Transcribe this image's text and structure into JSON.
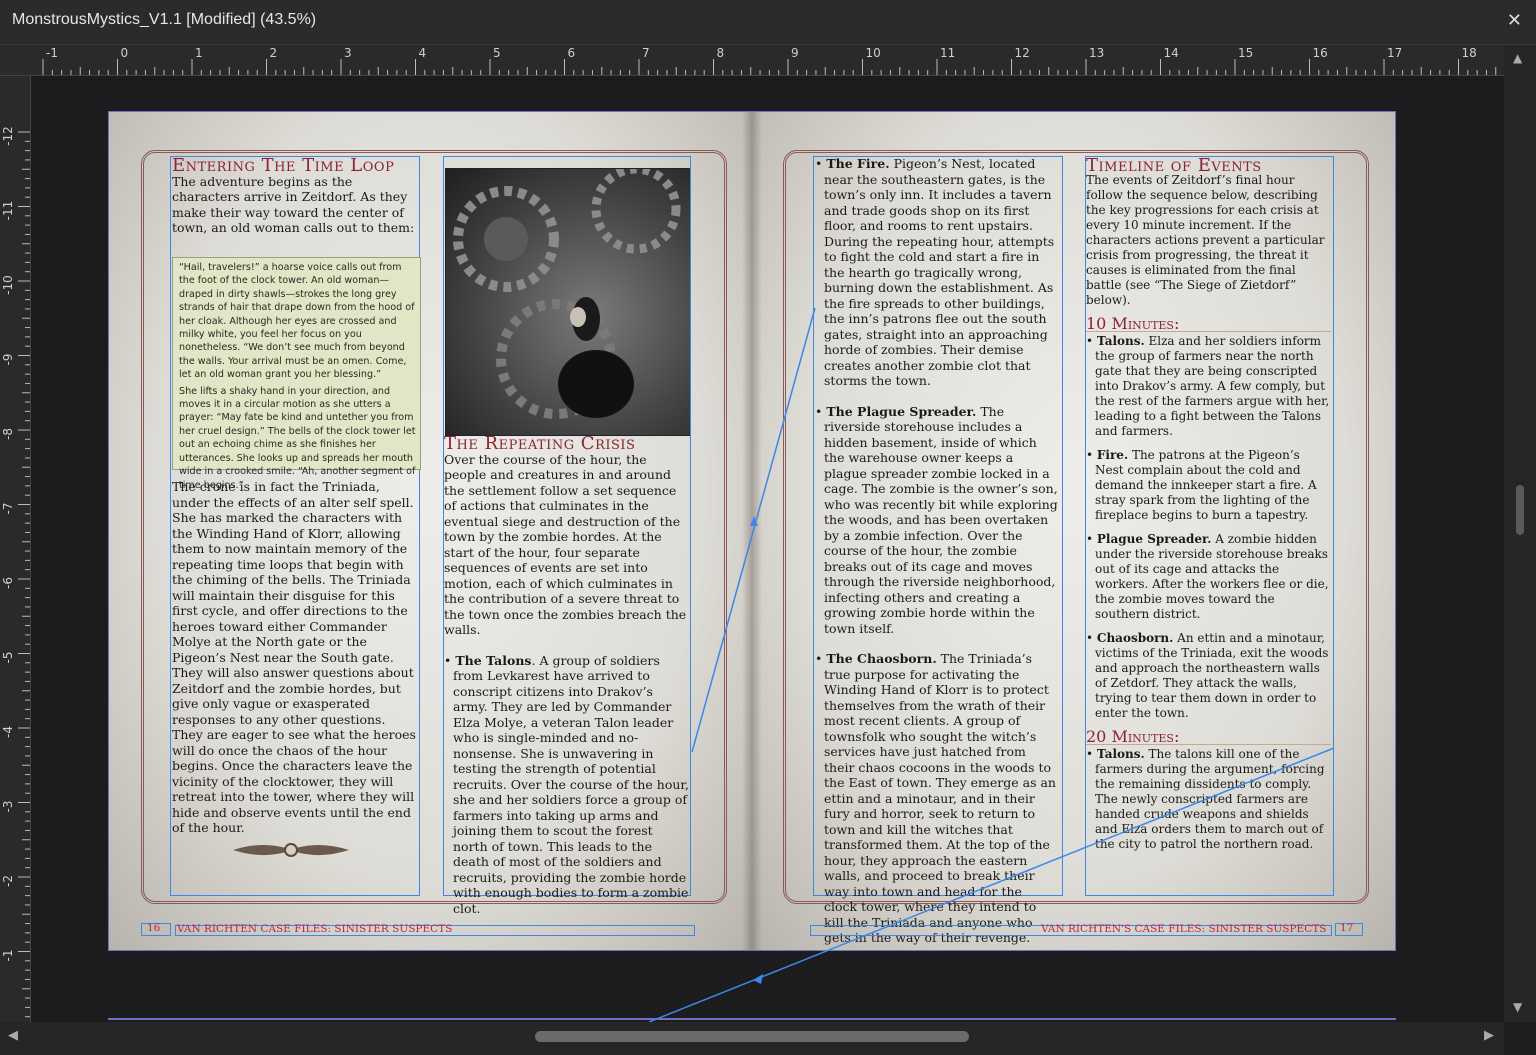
{
  "window": {
    "title": "MonstrousMystics_V1.1 [Modified] (43.5%)",
    "close_glyph": "✕"
  },
  "ruler": {
    "unit": "in",
    "h_labels": [
      "-1",
      "0",
      "1",
      "2",
      "3",
      "4",
      "5",
      "6",
      "7",
      "8",
      "9",
      "10",
      "11",
      "12",
      "13",
      "14",
      "15",
      "16",
      "17",
      "18"
    ],
    "v_labels": [
      "-12",
      "-11",
      "-10",
      "-9",
      "-8",
      "-7",
      "-6",
      "-5",
      "-4",
      "-3",
      "-2",
      "-1"
    ]
  },
  "left_page": {
    "h1": "Entering The Time Loop",
    "intro": "The adventure begins as the characters arrive in Zeitdorf. As they make their way toward the center of town, an old woman calls out to them:",
    "box_p1": "“Hail, travelers!” a hoarse voice calls out from the foot of the clock tower. An old woman—draped in dirty shawls—strokes the long grey strands of hair that drape down from the hood of her cloak. Although her eyes are crossed and milky white, you feel her focus on you nonetheless. “We don’t see much from beyond the walls. Your arrival must be an omen. Come, let an old woman grant you her blessing.”",
    "box_p2": "She lifts a shaky hand in your direction, and moves it in a circular motion as she utters a prayer: “May fate be kind and untether you from her cruel design.” The bells of the clock tower let out an echoing chime as she finishes her utterances. She looks up and spreads her mouth wide in a crooked smile. “Ah, another segment of time begins.”",
    "body": "The crone is in fact the Triniada, under the effects of an alter self spell. She has marked the characters with the Winding Hand of Klorr, allowing them to now maintain memory of the repeating time loops that begin with the chiming of the bells. The Triniada will maintain their disguise for this first cycle, and offer directions to the heroes toward either Commander Molye at the North gate or the Pigeon’s Nest near the South gate. They will also answer questions about Zeitdorf and the zombie hordes, but give only vague or exasperated responses to any other questions. They are eager to see what the heroes will do once the chaos of the hour begins. Once the characters leave the vicinity of the clocktower, they will retreat into the tower, where they will hide and observe events until the end of the hour.",
    "h2": "The Repeating Crisis",
    "crisis": "Over the course of the hour, the people and creatures in and around the settlement follow a set sequence of actions that culminates in the eventual siege and destruction of the town by the zombie hordes. At the start of the hour, four separate sequences of events are set into motion, each of which culminates in the contribution of a severe threat to the town once the zombies breach the walls.",
    "talons_title": "The Talons",
    "talons": "A group of soldiers from Levkarest have arrived to conscript citizens into Drakov’s army. They are led by Commander Elza Molye, a veteran Talon leader who is single-minded and no-nonsense. She is unwavering in testing the strength of potential recruits. Over the course of the hour, she and her soldiers force a group of farmers into taking up arms and joining them to scout the forest north of town. This leads to the death of most of the soldiers and recruits, providing the zombie horde with enough bodies to form a zombie clot.",
    "page_no": "16",
    "footer": "VAN RICHTEN CASE FILES: SINISTER SUSPECTS"
  },
  "right_page": {
    "fire_title": "The Fire.",
    "fire": "Pigeon’s Nest, located near the southeastern gates, is the town’s only inn. It includes a tavern and trade goods shop on its first floor, and rooms to rent upstairs. During the repeating hour, attempts to fight the cold and start a fire in the hearth go tragically wrong, burning down the establishment. As the fire spreads to other buildings, the inn’s patrons flee out the south gates, straight into an approaching horde of zombies. Their demise creates another zombie clot that storms the town.",
    "plague_title": "The Plague Spreader.",
    "plague": "The riverside storehouse includes a hidden basement, inside of which the warehouse owner keeps a plague spreader zombie locked in a cage. The zombie is the owner’s son, who was recently bit while exploring the woods, and has been overtaken by a zombie infection. Over the course of the hour, the zombie breaks out of its cage and moves through the riverside neighborhood, infecting others and creating a growing zombie horde within the town itself.",
    "chaos_title": "The Chaosborn.",
    "chaos": "The Triniada’s true purpose for activating the Winding Hand of Klorr is to protect themselves from the wrath of their most recent clients. A group of townsfolk who sought the witch’s services have just hatched from their chaos cocoons in the woods to the East of town. They emerge as an ettin and a minotaur, and in their fury and horror, seek to return to town and kill the witches that transformed them. At the top of the hour, they approach the eastern walls, and proceed to break their way into town and head for the clock tower, where they intend to kill the Triniada and anyone who gets in the way of their revenge.",
    "h3": "Timeline of Events",
    "timeline": "The events of Zeitdorf’s final hour follow the sequence below, describing the key progressions for each crisis at every 10 minute increment. If the characters actions prevent a particular crisis from progressing, the threat it causes is eliminated from the final battle (see “The Siege of Zietdorf” below).",
    "m10": "10 Minutes:",
    "m10_items": [
      {
        "t": "Talons.",
        "d": "Elza and her soldiers inform the group of farmers near the north gate that they are being conscripted into Drakov’s army. A few comply, but the rest of the farmers argue with her, leading to a fight between the Talons and farmers."
      },
      {
        "t": "Fire.",
        "d": "The patrons at the Pigeon’s Nest complain about the cold and demand the innkeeper start a fire. A stray spark from the lighting of the fireplace begins to burn a tapestry."
      },
      {
        "t": "Plague Spreader.",
        "d": "A zombie hidden under the riverside storehouse breaks out of its cage and attacks the workers. After the workers flee or die, the zombie moves toward the southern district."
      },
      {
        "t": "Chaosborn.",
        "d": "An ettin and a minotaur, victims of the Triniada, exit the woods and approach the northeastern walls of Zetdorf. They attack the walls, trying to tear them down in order to enter the town."
      }
    ],
    "m20": "20 Minutes:",
    "m20_items": [
      {
        "t": "Talons.",
        "d": "The talons kill one of the farmers during the argument, forcing the remaining dissidents to comply. The newly conscripted farmers are handed crude weapons and shields and Elza orders them to march out of the city to patrol the northern road."
      }
    ],
    "page_no": "17",
    "footer": "VAN RICHTEN'S CASE FILES: SINISTER SUSPECTS"
  },
  "pilcrow": "¶",
  "colors": {
    "heading": "#8b2330",
    "frame_select": "#3e86e8",
    "footer": "#c0254a",
    "box_bg": "#e2e5c6"
  },
  "icons": {
    "scroll_up": "▲",
    "scroll_down": "▼",
    "scroll_left": "◀",
    "scroll_right": "▶"
  }
}
